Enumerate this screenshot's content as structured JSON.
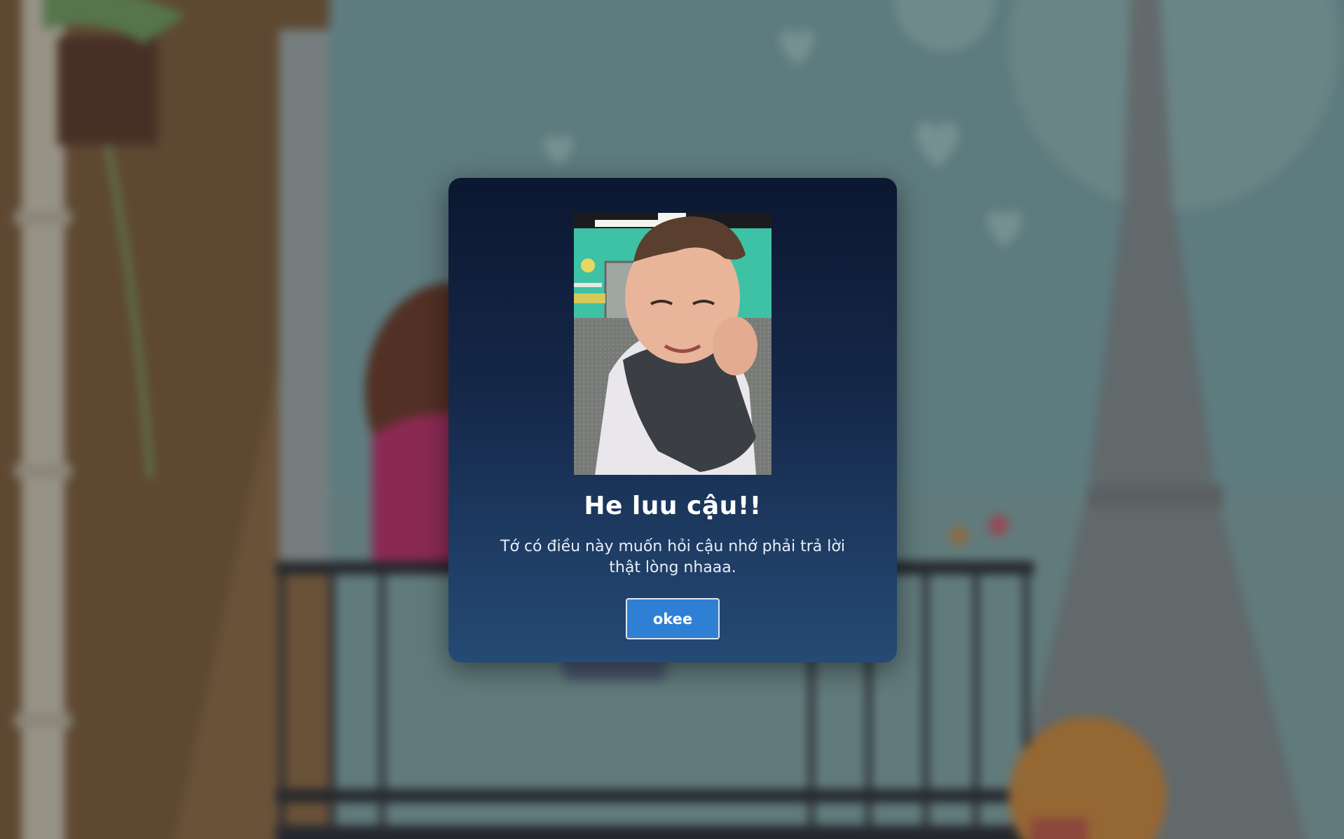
{
  "modal": {
    "title": "He luu cậu!!",
    "message": "Tớ có điều này muốn hỏi cậu nhớ phải trả lời thật lòng nhaaa.",
    "button_label": "okee"
  },
  "colors": {
    "modal_top": "#0c1730",
    "modal_bottom": "#254a74",
    "button": "#2f7fd4"
  }
}
